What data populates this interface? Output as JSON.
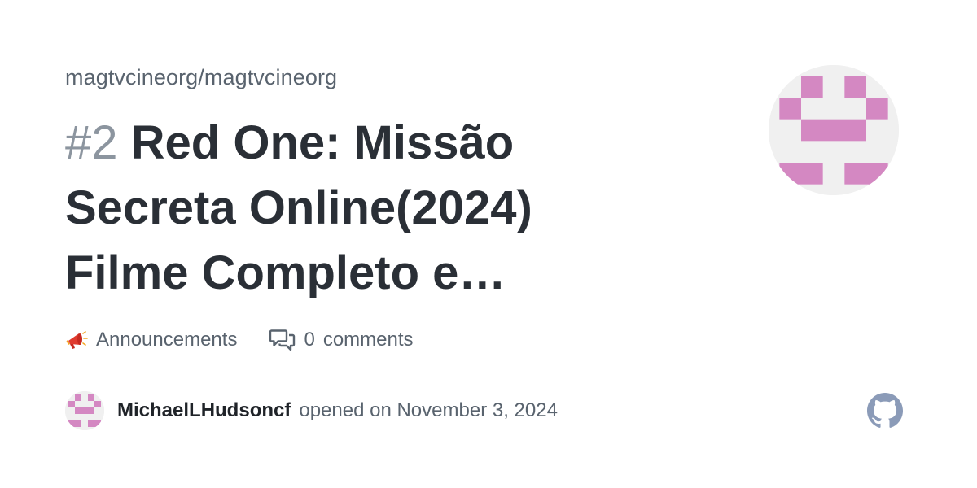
{
  "repo": "magtvcineorg/magtvcineorg",
  "discussion": {
    "number": "#2",
    "title_lines": [
      "Red One: Missão",
      "Secreta Online(2024)",
      "Filme Completo e…"
    ]
  },
  "category": {
    "icon": "megaphone-icon",
    "label": "Announcements"
  },
  "comments": {
    "icon": "comment-discussion-icon",
    "count": "0",
    "label": "comments"
  },
  "author": {
    "username": "MichaelLHudsoncf",
    "action": "opened on November 3, 2024"
  },
  "colors": {
    "identicon": "#d488c2",
    "identicon_bg": "#f0f0f0",
    "github_logo": "#8b9bb8"
  }
}
